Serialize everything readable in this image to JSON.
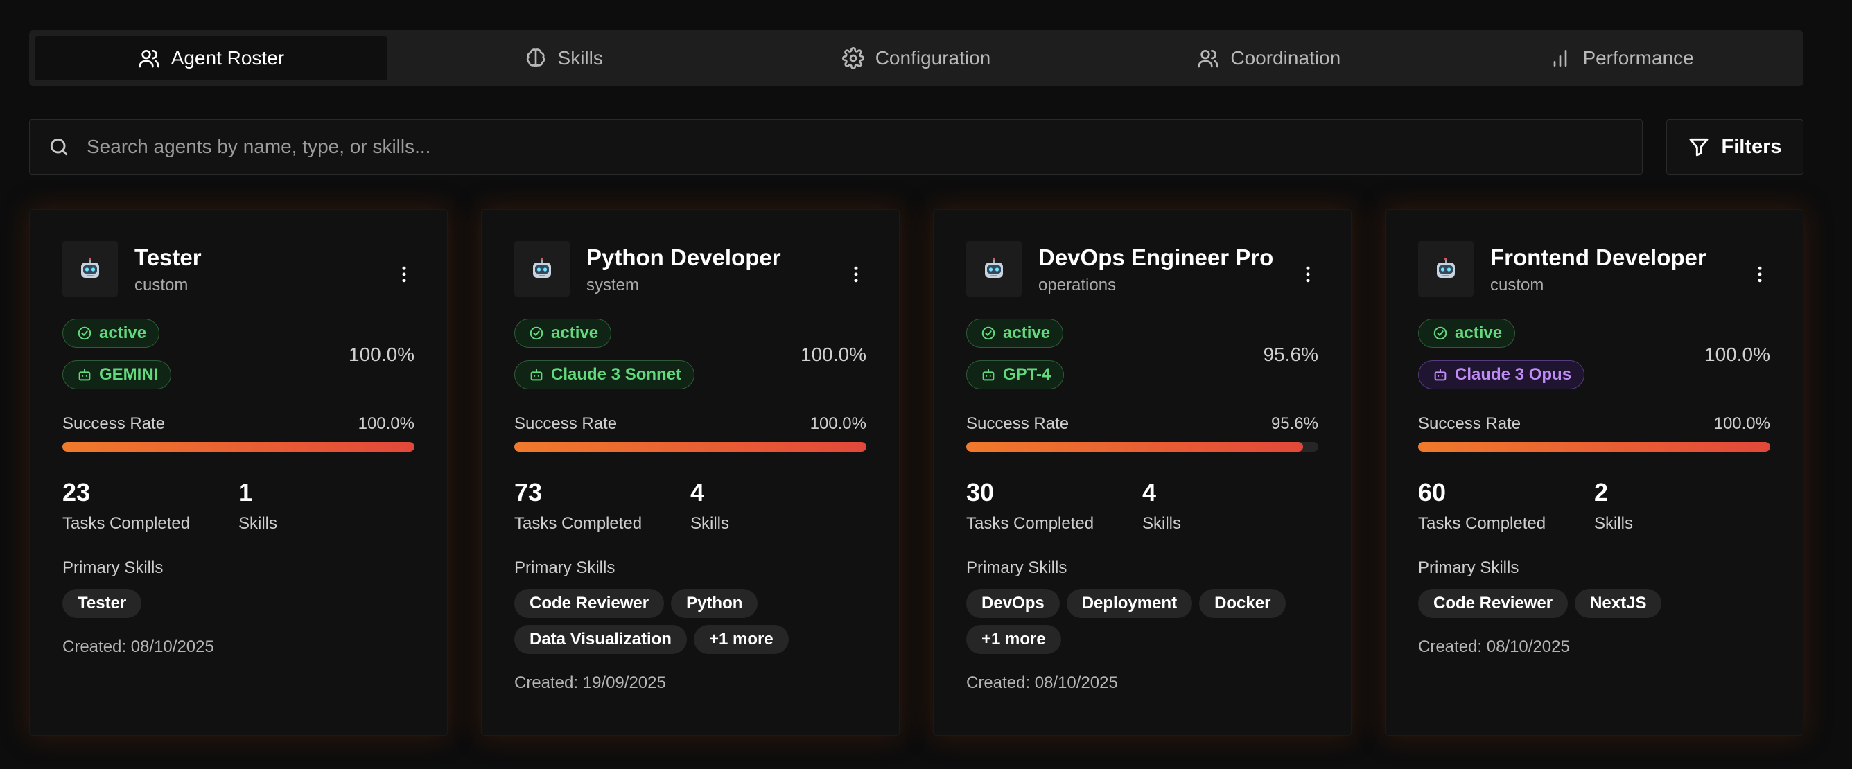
{
  "tabs": [
    {
      "label": "Agent Roster",
      "icon": "users-icon",
      "active": true
    },
    {
      "label": "Skills",
      "icon": "brain-icon",
      "active": false
    },
    {
      "label": "Configuration",
      "icon": "gear-icon",
      "active": false
    },
    {
      "label": "Coordination",
      "icon": "users-icon",
      "active": false
    },
    {
      "label": "Performance",
      "icon": "bar-chart-icon",
      "active": false
    }
  ],
  "search": {
    "placeholder": "Search agents by name, type, or skills..."
  },
  "filters_label": "Filters",
  "labels": {
    "success_rate": "Success Rate",
    "tasks_completed": "Tasks Completed",
    "skills": "Skills",
    "primary_skills": "Primary Skills"
  },
  "agents": [
    {
      "name": "Tester",
      "type": "custom",
      "status": "active",
      "model": "GEMINI",
      "model_color": "green",
      "rate": "100.0%",
      "rate_value": 100.0,
      "tasks": "23",
      "skill_count": "1",
      "skills": [
        "Tester"
      ],
      "created": "Created: 08/10/2025"
    },
    {
      "name": "Python Developer",
      "type": "system",
      "status": "active",
      "model": "Claude 3 Sonnet",
      "model_color": "green",
      "rate": "100.0%",
      "rate_value": 100.0,
      "tasks": "73",
      "skill_count": "4",
      "skills": [
        "Code Reviewer",
        "Python",
        "Data Visualization",
        "+1 more"
      ],
      "created": "Created: 19/09/2025"
    },
    {
      "name": "DevOps Engineer Pro",
      "type": "operations",
      "status": "active",
      "model": "GPT-4",
      "model_color": "green",
      "rate": "95.6%",
      "rate_value": 95.6,
      "tasks": "30",
      "skill_count": "4",
      "skills": [
        "DevOps",
        "Deployment",
        "Docker",
        "+1 more"
      ],
      "created": "Created: 08/10/2025"
    },
    {
      "name": "Frontend Developer",
      "type": "custom",
      "status": "active",
      "model": "Claude 3 Opus",
      "model_color": "purple",
      "rate": "100.0%",
      "rate_value": 100.0,
      "tasks": "60",
      "skill_count": "2",
      "skills": [
        "Code Reviewer",
        "NextJS"
      ],
      "created": "Created: 08/10/2025"
    }
  ],
  "colors": {
    "accent_orange": "#f07a2c",
    "accent_red": "#e2483a",
    "status_green": "#63d97e",
    "model_purple": "#c08cf5"
  }
}
